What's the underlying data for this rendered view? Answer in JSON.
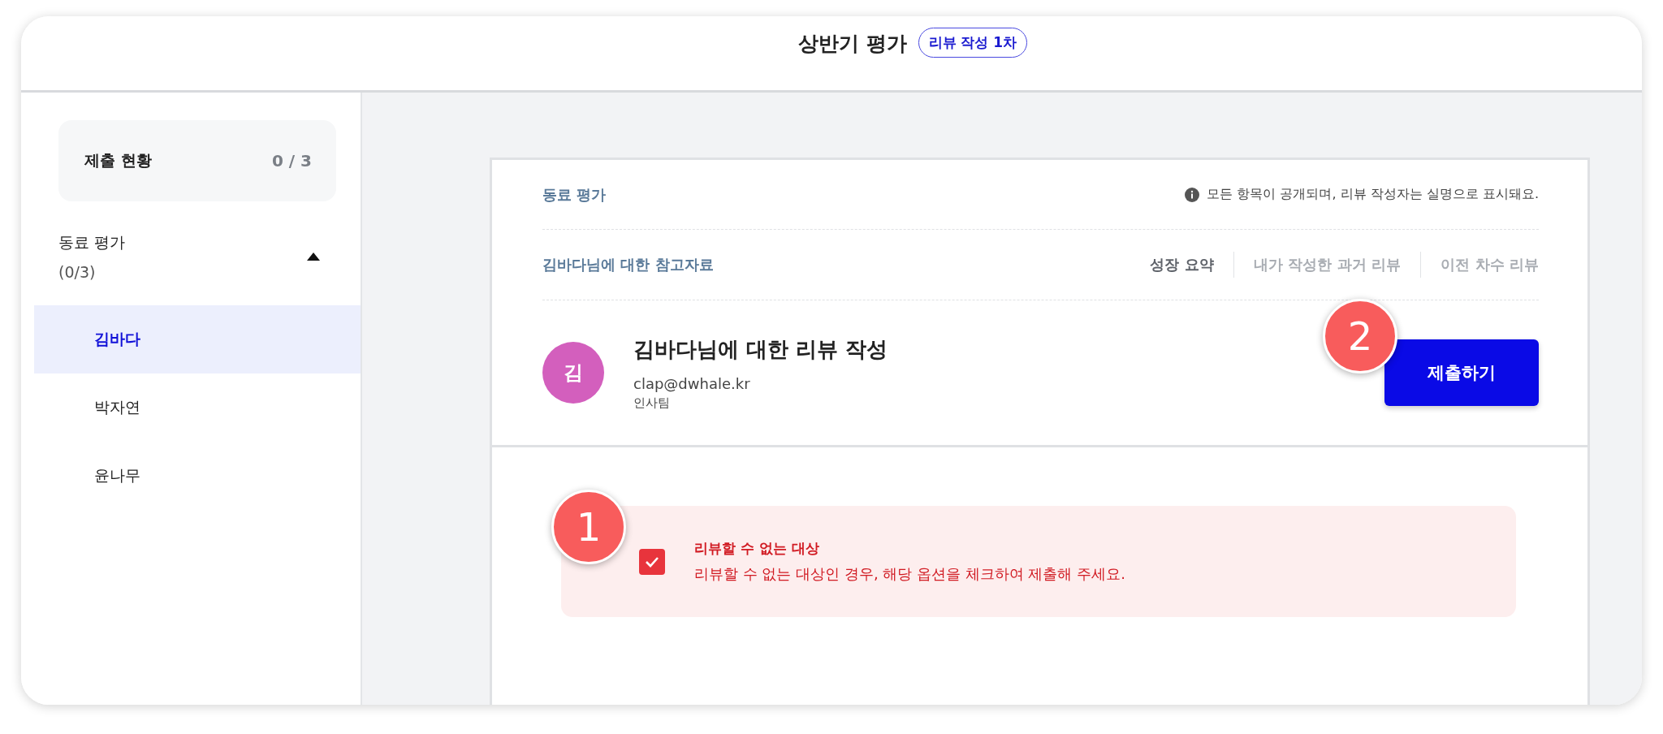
{
  "header": {
    "title": "상반기 평가",
    "badge": "리뷰 작성 1차"
  },
  "sidebar": {
    "summary": {
      "label": "제출 현황",
      "count": "0 / 3"
    },
    "group": {
      "label": "동료 평가",
      "count": "(0/3)",
      "expanded": true,
      "items": [
        {
          "name": "김바다",
          "selected": true
        },
        {
          "name": "박자연",
          "selected": false
        },
        {
          "name": "윤나무",
          "selected": false
        }
      ]
    }
  },
  "card": {
    "section_title": "동료 평가",
    "notice": "모든 항목이 공개되며, 리뷰 작성자는 실명으로 표시돼요.",
    "reference_title": "김바다님에 대한 참고자료",
    "reference_tabs": [
      {
        "label": "성장 요약",
        "selected": true
      },
      {
        "label": "내가 작성한 과거 리뷰",
        "selected": false
      },
      {
        "label": "이전 차수 리뷰",
        "selected": false
      }
    ],
    "profile": {
      "avatar": "김",
      "title": "김바다님에 대한 리뷰 작성",
      "email": "clap@dwhale.kr",
      "team": "인사팀"
    },
    "submit": "제출하기",
    "option": {
      "checked": true,
      "title": "리뷰할 수 없는 대상",
      "description": "리뷰할 수 없는 대상인 경우, 해당 옵션을 체크하여 제출해 주세요."
    }
  },
  "callouts": [
    "1",
    "2"
  ]
}
